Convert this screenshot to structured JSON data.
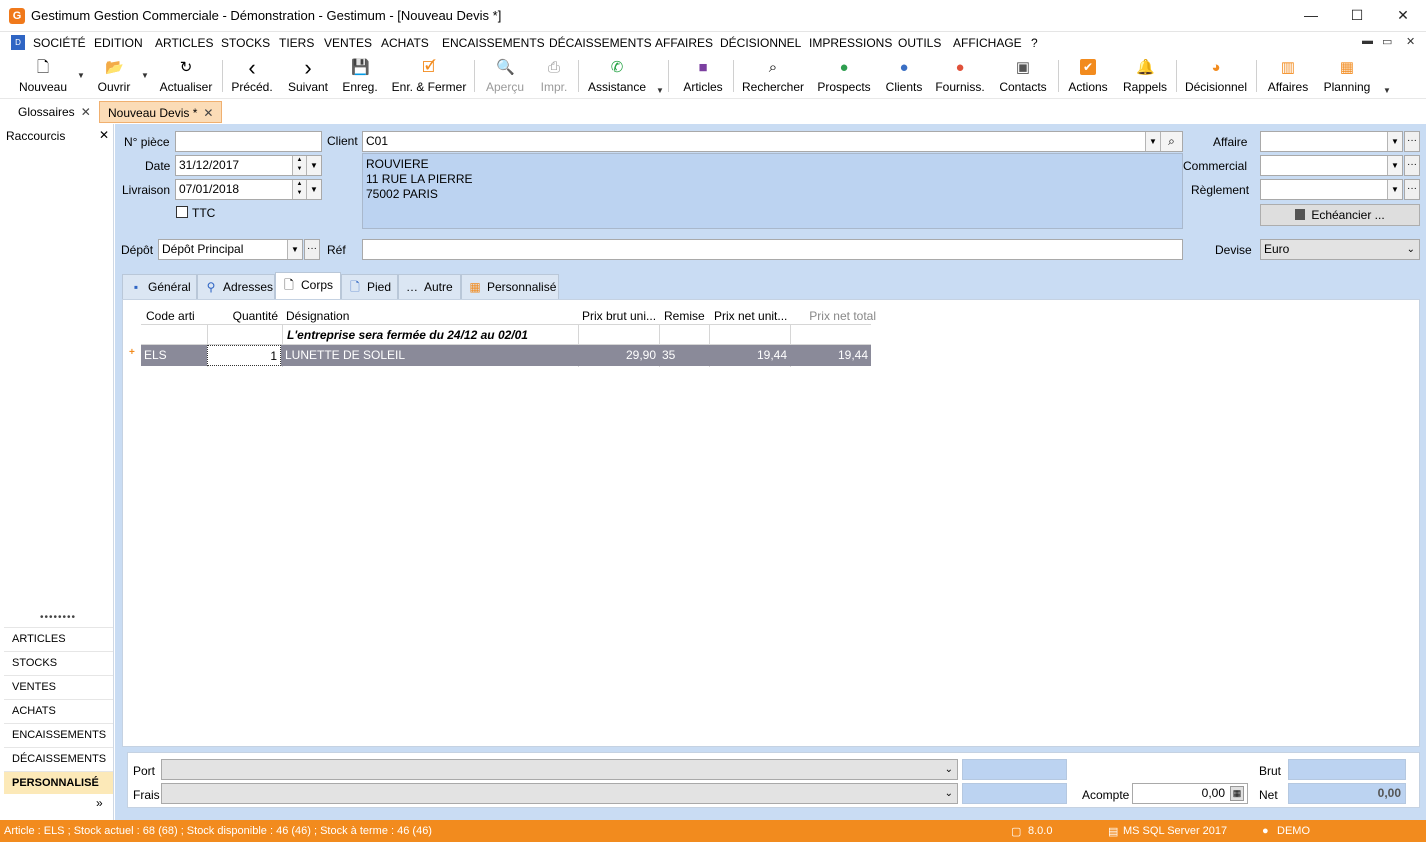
{
  "window": {
    "title": "Gestimum Gestion Commerciale - Démonstration - Gestimum - [Nouveau Devis *]",
    "logo": "G",
    "controls": [
      "—",
      "☐",
      "✕"
    ]
  },
  "menu": {
    "items": [
      "SOCIÉTÉ",
      "EDITION",
      "ARTICLES",
      "STOCKS",
      "TIERS",
      "VENTES",
      "ACHATS",
      "ENCAISSEMENTS",
      "DÉCAISSEMENTS",
      "AFFAIRES",
      "DÉCISIONNEL",
      "IMPRESSIONS",
      "OUTILS",
      "AFFICHAGE",
      "?"
    ],
    "mdi_controls": [
      "▬",
      "▭",
      "✕"
    ]
  },
  "toolbar": {
    "buttons": [
      {
        "label": "Nouveau",
        "icon": "new-document-icon",
        "glyph": "🗋"
      },
      {
        "label": "Ouvrir",
        "icon": "folder-open-icon",
        "glyph": "📂"
      },
      {
        "label": "Actualiser",
        "icon": "refresh-icon",
        "glyph": "↻"
      },
      {
        "label": "Précéd.",
        "icon": "chevron-left-icon",
        "glyph": "‹"
      },
      {
        "label": "Suivant",
        "icon": "chevron-right-icon",
        "glyph": "›"
      },
      {
        "label": "Enreg.",
        "icon": "save-icon",
        "glyph": "💾"
      },
      {
        "label": "Enr. & Fermer",
        "icon": "save-close-icon",
        "glyph": "🗹"
      },
      {
        "label": "Aperçu",
        "icon": "preview-icon",
        "glyph": "🔍"
      },
      {
        "label": "Impr.",
        "icon": "print-icon",
        "glyph": "⎙"
      },
      {
        "label": "Assistance",
        "icon": "whatsapp-icon",
        "glyph": "✆"
      },
      {
        "label": "Articles",
        "icon": "articles-icon",
        "glyph": "■"
      },
      {
        "label": "Rechercher",
        "icon": "search-people-icon",
        "glyph": "⌕"
      },
      {
        "label": "Prospects",
        "icon": "prospects-icon",
        "glyph": "●"
      },
      {
        "label": "Clients",
        "icon": "clients-icon",
        "glyph": "●"
      },
      {
        "label": "Fourniss.",
        "icon": "suppliers-icon",
        "glyph": "●"
      },
      {
        "label": "Contacts",
        "icon": "contacts-icon",
        "glyph": "▣"
      },
      {
        "label": "Actions",
        "icon": "actions-icon",
        "glyph": "✔"
      },
      {
        "label": "Rappels",
        "icon": "bell-icon",
        "glyph": "🔔"
      },
      {
        "label": "Décisionnel",
        "icon": "pie-chart-icon",
        "glyph": "◕"
      },
      {
        "label": "Affaires",
        "icon": "bar-chart-icon",
        "glyph": "▥"
      },
      {
        "label": "Planning",
        "icon": "planning-icon",
        "glyph": "▦"
      }
    ],
    "colors": {
      "articles": "#7b3fa0",
      "prospects": "#2e9e4f",
      "clients": "#3a6fc4",
      "suppliers": "#e0513a",
      "actions": "#f28b1e",
      "rappels": "#f28b1e",
      "decisionnel": "#f28b1e",
      "assistance": "#25a244"
    }
  },
  "doc_tabs": [
    {
      "label": "Glossaires",
      "close": "✕"
    },
    {
      "label": "Nouveau Devis *",
      "close": "✕"
    }
  ],
  "sidebar": {
    "title": "Raccourcis",
    "close": "✕",
    "grip": "••••••••",
    "items": [
      "ARTICLES",
      "STOCKS",
      "VENTES",
      "ACHATS",
      "ENCAISSEMENTS",
      "DÉCAISSEMENTS",
      "PERSONNALISÉ"
    ],
    "more": "»"
  },
  "header_form": {
    "piece_label": "N° pièce",
    "piece_value": "",
    "date_label": "Date",
    "date_value": "31/12/2017",
    "livraison_label": "Livraison",
    "livraison_value": "07/01/2018",
    "ttc_label": "TTC",
    "client_label": "Client",
    "client_value": "C01",
    "address_lines": [
      "ROUVIERE",
      "11 RUE LA PIERRE",
      "75002 PARIS"
    ],
    "affaire_label": "Affaire",
    "commercial_label": "Commercial",
    "reglement_label": "Règlement",
    "echeancier_label": "Echéancier ...",
    "depot_label": "Dépôt",
    "depot_value": "Dépôt Principal",
    "ref_label": "Réf",
    "ref_value": "",
    "devise_label": "Devise",
    "devise_value": "Euro"
  },
  "inner_tabs": [
    {
      "label": "Général",
      "glyph": "▪"
    },
    {
      "label": "Adresses",
      "glyph": "⚲"
    },
    {
      "label": "Corps",
      "glyph": "🗋"
    },
    {
      "label": "Pied",
      "glyph": "🗋"
    },
    {
      "label": "Autre",
      "glyph": "…"
    },
    {
      "label": "Personnalisé",
      "glyph": "▦"
    }
  ],
  "grid": {
    "columns": [
      "Code arti",
      "Quantité",
      "Désignation",
      "Prix brut uni...",
      "Remise",
      "Prix net unit...",
      "Prix net total"
    ],
    "comment_row": "L'entreprise sera fermée du 24/12 au 02/01",
    "row": {
      "marker": "+",
      "code": "ELS",
      "quantite": "1",
      "designation": "LUNETTE DE SOLEIL",
      "prix_brut": "29,90",
      "remise": "35",
      "prix_net_unit": "19,44",
      "prix_net_total": "19,44"
    }
  },
  "footer": {
    "port_label": "Port",
    "frais_label": "Frais",
    "acompte_label": "Acompte",
    "acompte_value": "0,00",
    "brut_label": "Brut",
    "net_label": "Net",
    "net_value": "0,00"
  },
  "status": {
    "text": "Article : ELS ; Stock actuel : 68 (68) ; Stock disponible : 46 (46) ; Stock à terme : 46 (46)",
    "version": "8.0.0",
    "db": "MS SQL Server 2017",
    "user": "DEMO"
  }
}
